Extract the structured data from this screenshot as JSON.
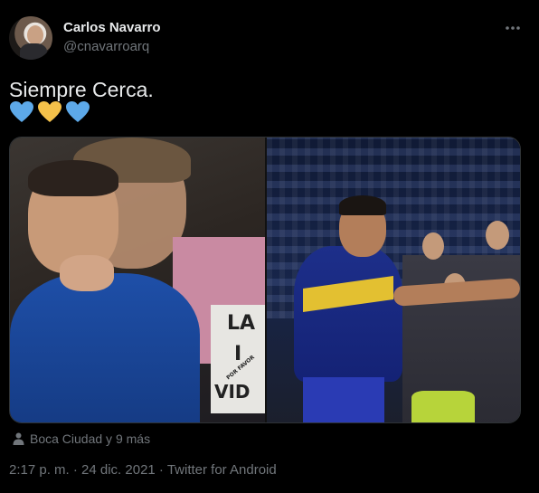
{
  "author": {
    "display_name": "Carlos Navarro",
    "handle": "@cnavarroarq"
  },
  "tweet": {
    "text": "Siempre Cerca.",
    "emojis": [
      "blue-heart",
      "yellow-heart",
      "blue-heart"
    ],
    "media": {
      "left_photo_sign_text": [
        "LA",
        "I",
        "VID"
      ],
      "left_photo_sign_small": "POR FAVOR"
    },
    "tagged": "Boca Ciudad y 9 más",
    "timestamp": "2:17 p. m. · 24 dic. 2021 · Twitter for Android"
  },
  "colors": {
    "background": "#000000",
    "primary_text": "#e7e9ea",
    "secondary_text": "#71767b",
    "blue_heart": "#5da9e9",
    "yellow_heart": "#f4c14a"
  },
  "icons": {
    "more": "more-icon",
    "tagged_people": "person-icon"
  }
}
